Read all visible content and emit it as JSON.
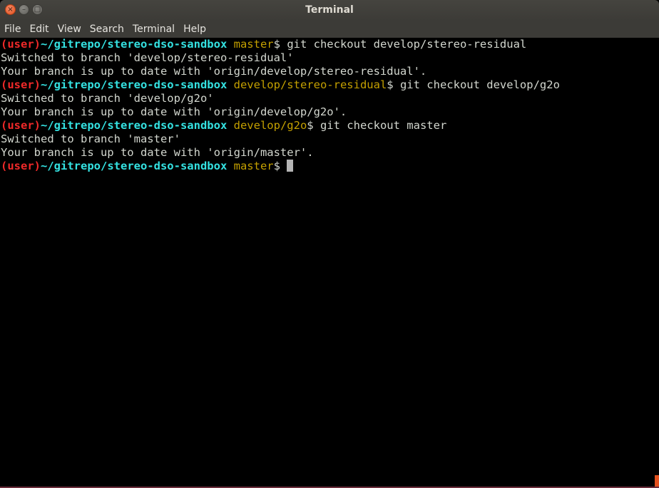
{
  "window": {
    "title": "Terminal"
  },
  "window_buttons": {
    "close_glyph": "×",
    "minimize_glyph": "–",
    "maximize_glyph": "□"
  },
  "menubar": {
    "items": [
      "File",
      "Edit",
      "View",
      "Search",
      "Terminal",
      "Help"
    ]
  },
  "prompt": {
    "user": "(user)",
    "path": "~/gitrepo/stereo-dso-sandbox"
  },
  "colors": {
    "user": "#ef2929",
    "path": "#34e2e2",
    "branch": "#c4a000",
    "text": "#d3d7cf",
    "background": "#000000"
  },
  "terminal": {
    "lines": [
      {
        "type": "prompt",
        "branch": "master",
        "command": "git checkout develop/stereo-residual"
      },
      {
        "type": "output",
        "text": "Switched to branch 'develop/stereo-residual'"
      },
      {
        "type": "output",
        "text": "Your branch is up to date with 'origin/develop/stereo-residual'."
      },
      {
        "type": "prompt",
        "branch": "develop/stereo-residual",
        "command": "git checkout develop/g2o"
      },
      {
        "type": "output",
        "text": "Switched to branch 'develop/g2o'"
      },
      {
        "type": "output",
        "text": "Your branch is up to date with 'origin/develop/g2o'."
      },
      {
        "type": "prompt",
        "branch": "develop/g2o",
        "command": "git checkout master"
      },
      {
        "type": "output",
        "text": "Switched to branch 'master'"
      },
      {
        "type": "output",
        "text": "Your branch is up to date with 'origin/master'."
      },
      {
        "type": "prompt",
        "branch": "master",
        "command": ""
      }
    ]
  }
}
